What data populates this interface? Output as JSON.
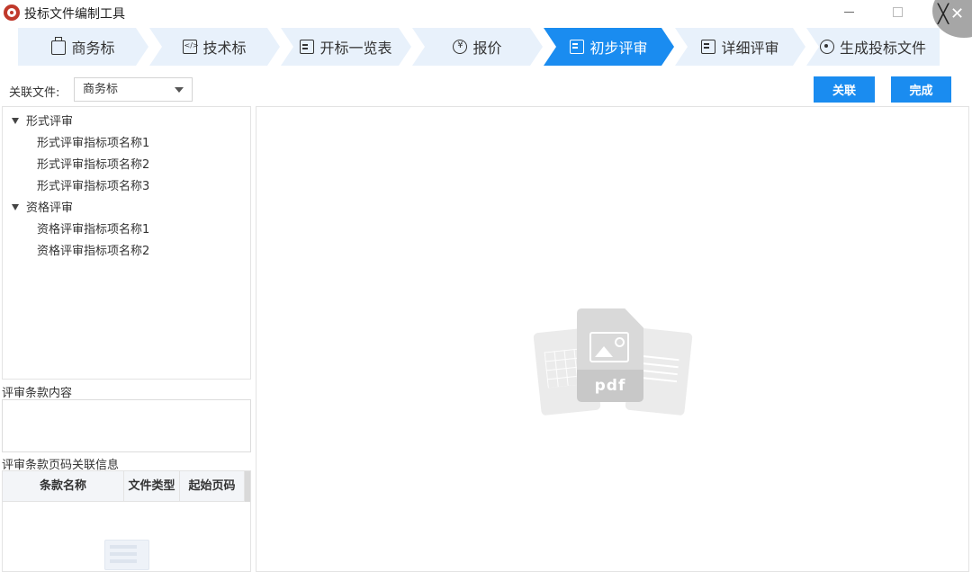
{
  "window": {
    "title": "投标文件编制工具",
    "close_glyph": "✕",
    "close_glyph_dark": "╳"
  },
  "steps": [
    {
      "label": "商务标",
      "icon": "briefcase-icon",
      "active": false
    },
    {
      "label": "技术标",
      "icon": "code-icon",
      "active": false
    },
    {
      "label": "开标一览表",
      "icon": "document-icon",
      "active": false
    },
    {
      "label": "报价",
      "icon": "yen-icon",
      "active": false
    },
    {
      "label": "初步评审",
      "icon": "checklist-icon",
      "active": true
    },
    {
      "label": "详细评审",
      "icon": "checklist-icon",
      "active": false
    },
    {
      "label": "生成投标文件",
      "icon": "target-icon",
      "active": false
    }
  ],
  "toolbar": {
    "assoc_label": "关联文件:",
    "assoc_selected": "商务标",
    "link_button": "关联",
    "done_button": "完成"
  },
  "tree": {
    "groups": [
      {
        "label": "形式评审",
        "items": [
          "形式评审指标项名称1",
          "形式评审指标项名称2",
          "形式评审指标项名称3"
        ]
      },
      {
        "label": "资格评审",
        "items": [
          "资格评审指标项名称1",
          "资格评审指标项名称2"
        ]
      }
    ]
  },
  "clause": {
    "content_label": "评审条款内容",
    "page_info_label": "评审条款页码关联信息"
  },
  "table": {
    "columns": [
      "条款名称",
      "文件类型",
      "起始页码"
    ]
  },
  "preview": {
    "placeholder_text": "pdf"
  },
  "colors": {
    "accent": "#1a8cf0",
    "step_inactive": "#e8f1fb"
  }
}
